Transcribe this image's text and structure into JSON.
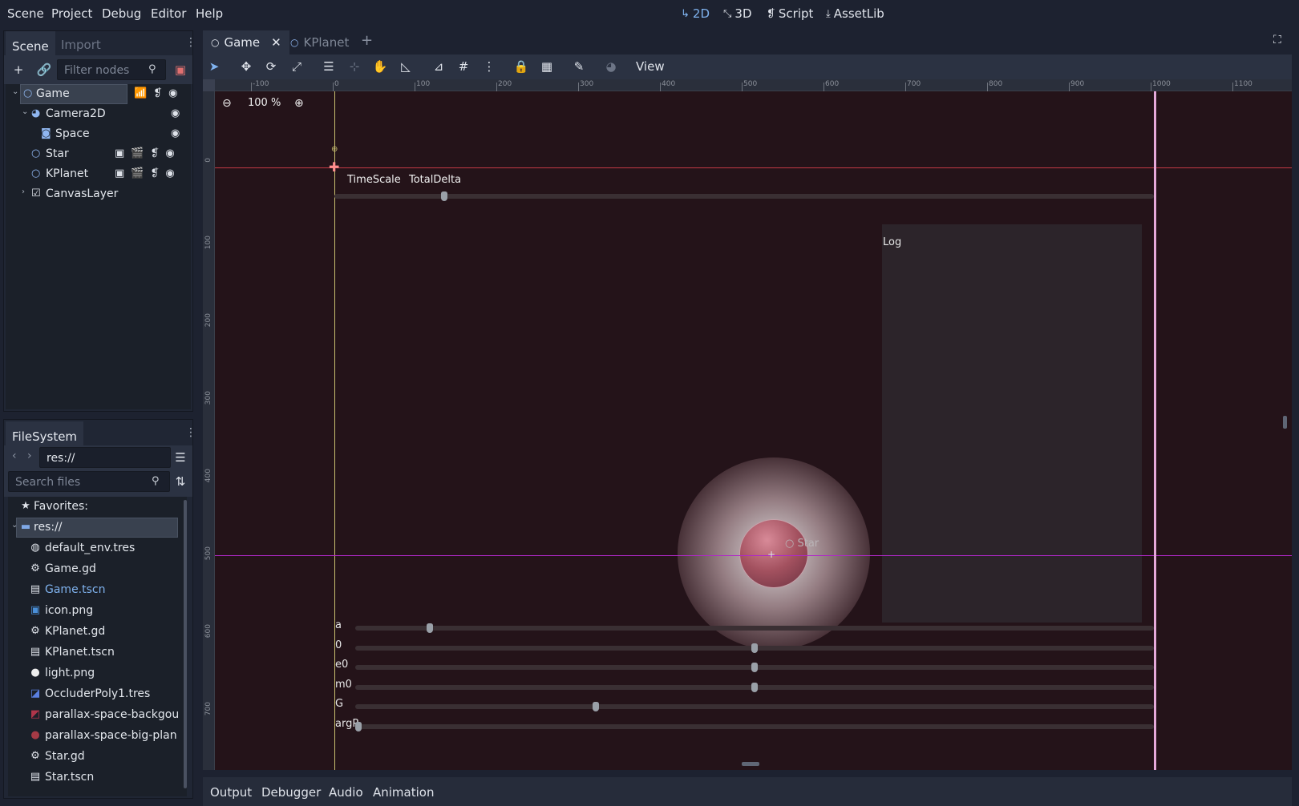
{
  "menu": [
    "Scene",
    "Project",
    "Debug",
    "Editor",
    "Help"
  ],
  "workspaces": [
    {
      "label": "2D",
      "icon": "2d-icon",
      "active": true
    },
    {
      "label": "3D",
      "icon": "3d-icon",
      "active": false
    },
    {
      "label": "Script",
      "icon": "script-icon",
      "active": false
    },
    {
      "label": "AssetLib",
      "icon": "assetlib-icon",
      "active": false
    }
  ],
  "scene_dock": {
    "tabs": [
      "Scene",
      "Import"
    ],
    "filter_placeholder": "Filter nodes",
    "tree": [
      {
        "label": "Game"
      },
      {
        "label": "Camera2D"
      },
      {
        "label": "Space"
      },
      {
        "label": "Star"
      },
      {
        "label": "KPlanet"
      },
      {
        "label": "CanvasLayer"
      }
    ]
  },
  "filesystem": {
    "tab": "FileSystem",
    "path": "res://",
    "search_placeholder": "Search files",
    "items": [
      {
        "label": "Favorites:",
        "icon": "star-icon"
      },
      {
        "label": "res://",
        "icon": "folder-icon"
      },
      {
        "label": "default_env.tres",
        "icon": "globe-icon"
      },
      {
        "label": "Game.gd",
        "icon": "gear-icon"
      },
      {
        "label": "Game.tscn",
        "icon": "clapper-icon"
      },
      {
        "label": "icon.png",
        "icon": "image-icon"
      },
      {
        "label": "KPlanet.gd",
        "icon": "gear-icon"
      },
      {
        "label": "KPlanet.tscn",
        "icon": "clapper-icon"
      },
      {
        "label": "light.png",
        "icon": "light-icon"
      },
      {
        "label": "OccluderPoly1.tres",
        "icon": "occluder-icon"
      },
      {
        "label": "parallax-space-backgou",
        "icon": "image-icon"
      },
      {
        "label": "parallax-space-big-plan",
        "icon": "image-icon"
      },
      {
        "label": "Star.gd",
        "icon": "gear-icon"
      },
      {
        "label": "Star.tscn",
        "icon": "clapper-icon"
      }
    ]
  },
  "editor_tabs": [
    {
      "label": "Game",
      "active": true
    },
    {
      "label": "KPlanet",
      "active": false
    }
  ],
  "toolbar": {
    "view_label": "View"
  },
  "viewport": {
    "zoom": "100 %",
    "ruler_h": [
      "-100",
      "0",
      "100",
      "200",
      "300",
      "400",
      "500",
      "600",
      "700",
      "800",
      "900",
      "1000",
      "1100"
    ],
    "ruler_v": [
      "0",
      "100",
      "200",
      "300",
      "400",
      "500",
      "600",
      "700"
    ],
    "labels": {
      "timescale": "TimeScale",
      "totaldelta": "TotalDelta",
      "log": "Log",
      "star": "Star"
    },
    "sliders": [
      {
        "label": "a",
        "value": 0.09
      },
      {
        "label": "0",
        "value": 0.5
      },
      {
        "label": "e0",
        "value": 0.5
      },
      {
        "label": "m0",
        "value": 0.5
      },
      {
        "label": "G",
        "value": 0.3
      },
      {
        "label": "argP",
        "value": 0.0
      }
    ],
    "top_slider_value": 0.13
  },
  "bottom_panel": [
    "Output",
    "Debugger",
    "Audio",
    "Animation"
  ]
}
